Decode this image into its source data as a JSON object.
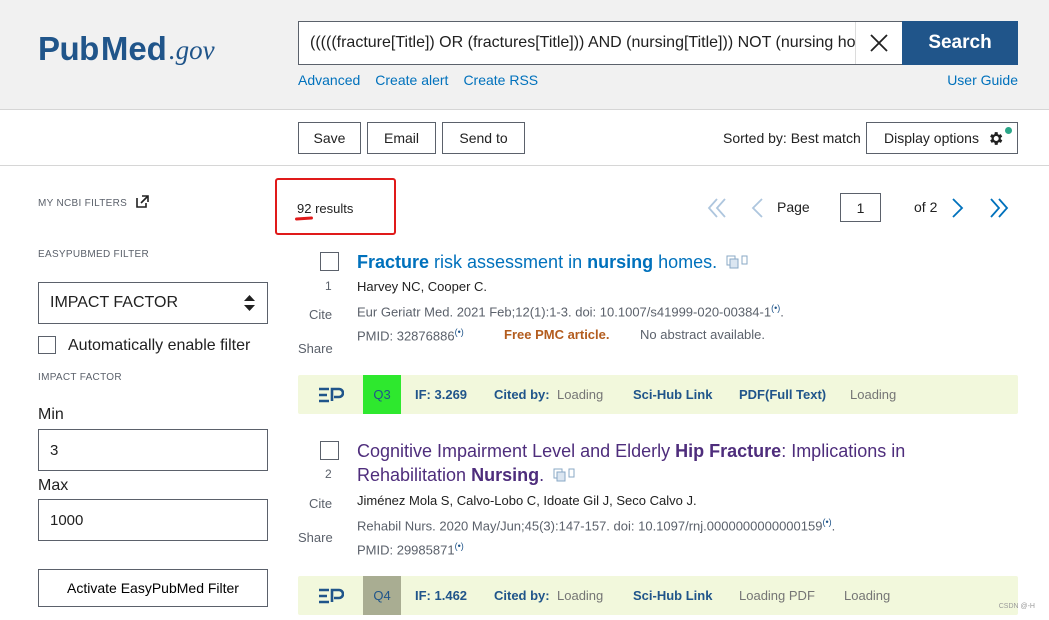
{
  "header": {
    "logo_pub": "Pub",
    "logo_med": "Med",
    "logo_gov": ".gov",
    "search_query": "(((((fracture[Title]) OR (fractures[Title])) AND (nursing[Title])) NOT (nursing ho",
    "search_button": "Search",
    "links": [
      "Advanced",
      "Create alert",
      "Create RSS"
    ],
    "user_guide": "User Guide"
  },
  "toolbar": {
    "save": "Save",
    "email": "Email",
    "send_to": "Send to",
    "sorted_by": "Sorted by: Best match",
    "display_options": "Display options"
  },
  "sidebar": {
    "my_ncbi_filters": "MY NCBI FILTERS",
    "easypubmed_filter": "EASYPUBMED FILTER",
    "filter_select": "IMPACT FACTOR",
    "auto_enable": "Automatically enable filter",
    "impact_factor_label": "IMPACT FACTOR",
    "min_label": "Min",
    "min_value": "3",
    "max_label": "Max",
    "max_value": "1000",
    "activate_button": "Activate EasyPubMed Filter"
  },
  "results": {
    "count_number": "92",
    "count_label": "results",
    "page_label": "Page",
    "page_value": "1",
    "of_pages": "of 2",
    "items": [
      {
        "number": "1",
        "title_parts": [
          "Fracture",
          " risk assessment in ",
          "nursing",
          " homes."
        ],
        "authors": "Harvey NC, Cooper C.",
        "citation": "Eur Geriatr Med. 2021 Feb;12(1):1-3. doi: 10.1007/s41999-020-00384-1",
        "citation_end": ".",
        "pmid": "PMID: 32876886",
        "free_pmc": "Free PMC article.",
        "no_abstract": "No abstract available.",
        "cite": "Cite",
        "share": "Share",
        "ep": {
          "quartile": "Q3",
          "quartile_color": "#2ee82e",
          "impact_factor": "IF: 3.269",
          "cited_by": "Cited by:",
          "cited_status": "Loading",
          "scihub": "Sci-Hub Link",
          "pdf": "PDF(Full Text)",
          "pdf_status": "Loading"
        }
      },
      {
        "number": "2",
        "title_line1_parts": [
          "Cognitive Impairment Level and Elderly ",
          "Hip Fracture",
          ": Implications in"
        ],
        "title_line2_parts": [
          "Rehabilitation ",
          "Nursing",
          "."
        ],
        "authors": "Jiménez Mola S, Calvo-Lobo C, Idoate Gil J, Seco Calvo J.",
        "citation": "Rehabil Nurs. 2020 May/Jun;45(3):147-157. doi: 10.1097/rnj.0000000000000159",
        "citation_end": ".",
        "pmid": "PMID: 29985871",
        "cite": "Cite",
        "share": "Share",
        "ep": {
          "quartile": "Q4",
          "quartile_color": "#a9ad92",
          "impact_factor": "IF: 1.462",
          "cited_by": "Cited by:",
          "cited_status": "Loading",
          "scihub": "Sci-Hub Link",
          "pdf": "Loading PDF",
          "pdf_status": "Loading"
        }
      }
    ]
  },
  "watermark": "CSDN @-H",
  "colors": {
    "brand": "#20558a",
    "link": "#0071bc",
    "visited": "#4e2d7c",
    "highlight": "#e01a1a"
  }
}
